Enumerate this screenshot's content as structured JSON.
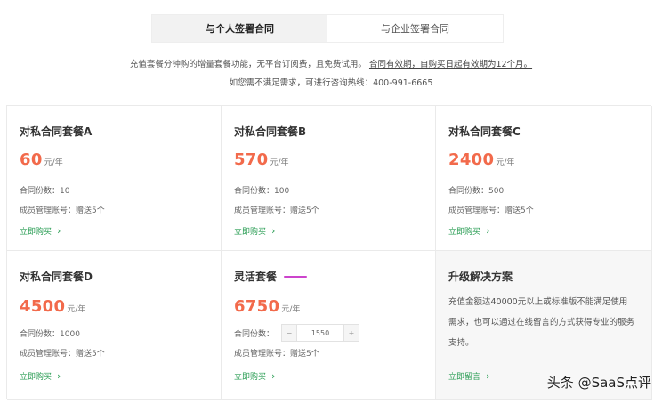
{
  "tabs": [
    {
      "label": "与个人签署合同",
      "active": true
    },
    {
      "label": "与企业签署合同",
      "active": false
    }
  ],
  "notice": {
    "line1_prefix": "充值套餐分钟购的增量套餐功能，无平台订阅费，且免费试用。",
    "line1_link": "合同有效期，自购买日起有效期为12个月。",
    "line2": "如您需不满足需求，可进行咨询热线：400-991-6665"
  },
  "packages": [
    {
      "title": "对私合同套餐A",
      "price": "60",
      "unit": "元/年",
      "contracts_label": "合同份数：",
      "contracts": "10",
      "members_label": "成员管理账号：",
      "members": "赠送5个",
      "buy": "立即购买"
    },
    {
      "title": "对私合同套餐B",
      "price": "570",
      "unit": "元/年",
      "contracts_label": "合同份数：",
      "contracts": "100",
      "members_label": "成员管理账号：",
      "members": "赠送5个",
      "buy": "立即购买"
    },
    {
      "title": "对私合同套餐C",
      "price": "2400",
      "unit": "元/年",
      "contracts_label": "合同份数：",
      "contracts": "500",
      "members_label": "成员管理账号：",
      "members": "赠送5个",
      "buy": "立即购买"
    },
    {
      "title": "对私合同套餐D",
      "price": "4500",
      "unit": "元/年",
      "contracts_label": "合同份数：",
      "contracts": "1000",
      "members_label": "成员管理账号：",
      "members": "赠送5个",
      "buy": "立即购买"
    }
  ],
  "flexible": {
    "title": "灵活套餐",
    "badge": "",
    "price": "6750",
    "unit": "元/年",
    "contracts_label": "合同份数：",
    "quantity": "1550",
    "minus": "−",
    "plus": "+",
    "members_label": "成员管理账号：",
    "members": "赠送5个",
    "buy": "立即购买"
  },
  "upgrade": {
    "title": "升级解决方案",
    "desc": "充值金额达40000元以上或标准版不能满足使用需求，也可以通过在线留言的方式获得专业的服务支持。",
    "contact": "立即留言"
  },
  "watermark": "头条 @SaaS点评",
  "colors": {
    "accent": "#f26a4b",
    "link": "#2a9d54",
    "badge": "#cc44cc"
  }
}
